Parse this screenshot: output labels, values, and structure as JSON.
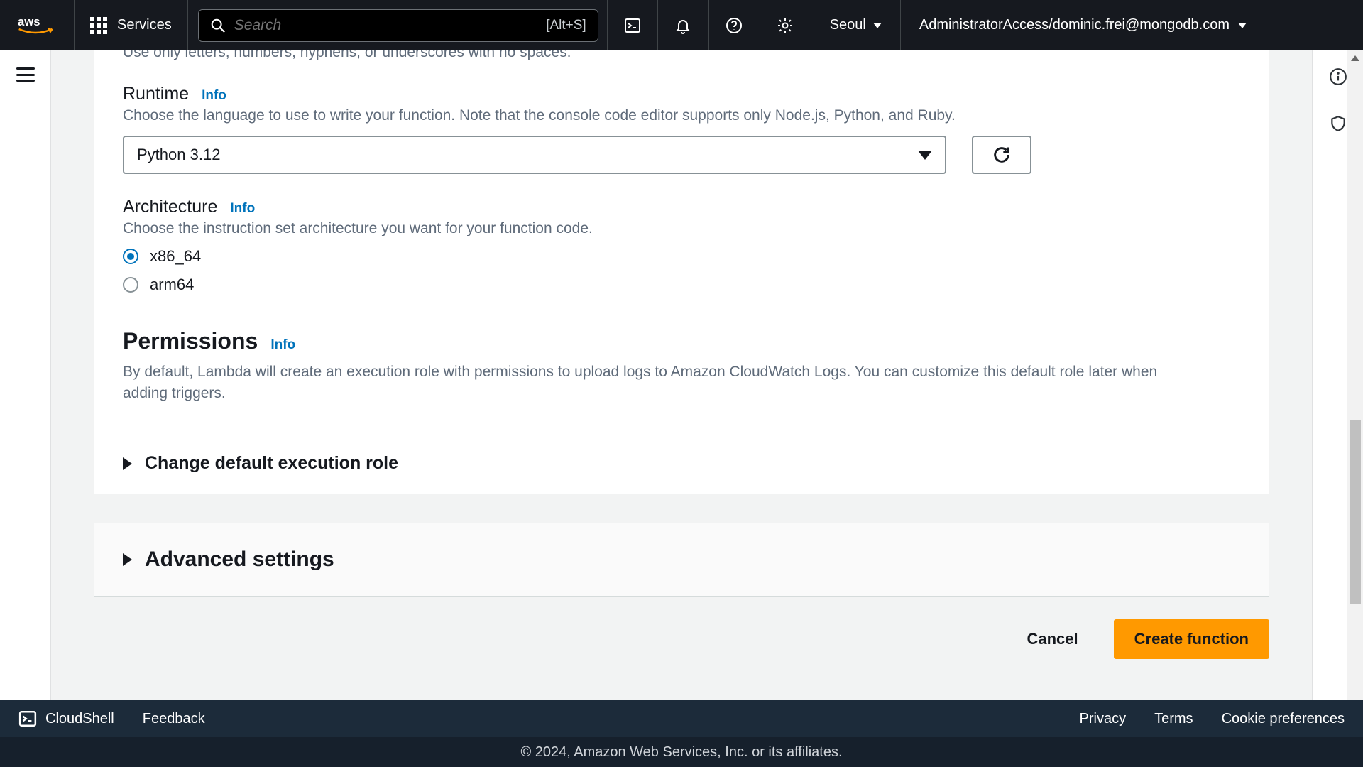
{
  "topnav": {
    "services_label": "Services",
    "search_placeholder": "Search",
    "search_shortcut": "[Alt+S]",
    "region": "Seoul",
    "account": "AdministratorAccess/dominic.frei@mongodb.com"
  },
  "form": {
    "name_hint_cut": "Use only letters, numbers, hyphens, or underscores with no spaces.",
    "runtime": {
      "label": "Runtime",
      "info": "Info",
      "help": "Choose the language to use to write your function. Note that the console code editor supports only Node.js, Python, and Ruby.",
      "selected": "Python 3.12"
    },
    "architecture": {
      "label": "Architecture",
      "info": "Info",
      "help": "Choose the instruction set architecture you want for your function code.",
      "options": {
        "x86": "x86_64",
        "arm": "arm64"
      },
      "selected": "x86_64"
    },
    "permissions": {
      "heading": "Permissions",
      "info": "Info",
      "desc": "By default, Lambda will create an execution role with permissions to upload logs to Amazon CloudWatch Logs. You can customize this default role later when adding triggers."
    },
    "change_role_label": "Change default execution role",
    "advanced_label": "Advanced settings",
    "cancel": "Cancel",
    "create": "Create function"
  },
  "footer": {
    "cloudshell": "CloudShell",
    "feedback": "Feedback",
    "privacy": "Privacy",
    "terms": "Terms",
    "cookies": "Cookie preferences",
    "copyright": "© 2024, Amazon Web Services, Inc. or its affiliates."
  }
}
